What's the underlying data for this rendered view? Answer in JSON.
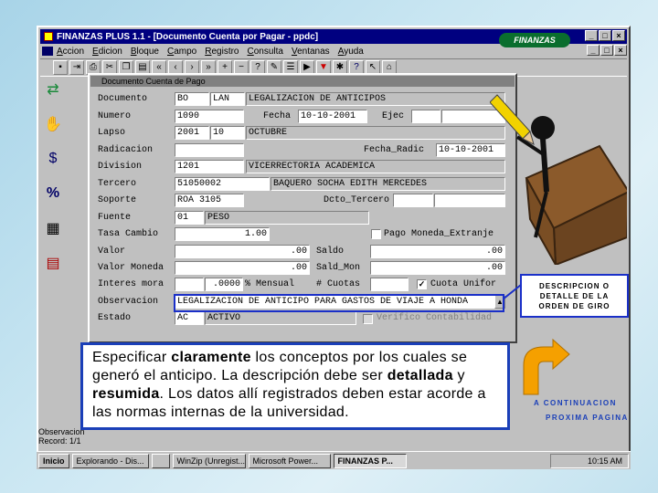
{
  "window": {
    "title": "FINANZAS PLUS 1.1 - [Documento Cuenta por Pagar - ppdc]",
    "menu": [
      "Accion",
      "Edicion",
      "Bloque",
      "Campo",
      "Registro",
      "Consulta",
      "Ventanas",
      "Ayuda"
    ],
    "brand": "FINANZAS"
  },
  "doc": {
    "title": "Documento Cuenta de Pago",
    "labels": {
      "documento": "Documento",
      "numero": "Numero",
      "fecha": "Fecha",
      "ejec": "Ejec",
      "lapso": "Lapso",
      "radicacion": "Radicacion",
      "fecha_radic": "Fecha_Radic",
      "division": "Division",
      "tercero": "Tercero",
      "soporte": "Soporte",
      "dcto_tercero": "Dcto_Tercero",
      "fuente": "Fuente",
      "tasa_cambio": "Tasa Cambio",
      "pago_moneda": "Pago Moneda_Extranje",
      "valor": "Valor",
      "saldo": "Saldo",
      "valor_moneda": "Valor Moneda",
      "saldo_mon": "Sald_Mon",
      "interes_mora": "Interes mora",
      "porc_mensual": "% Mensual",
      "num_cuotas": "# Cuotas",
      "cuota_unifor": "Cuota Unifor",
      "observacion": "Observacion",
      "estado": "Estado",
      "verifico": "Verifico Contabilidad"
    },
    "values": {
      "documento_a": "BO",
      "documento_b": "LAN",
      "documento_desc": "LEGALIZACION DE ANTICIPOS",
      "numero": "1090",
      "fecha": "10-10-2001",
      "ejec": "",
      "ejec2": "",
      "lapso_a": "2001",
      "lapso_b": "10",
      "lapso_desc": "OCTUBRE",
      "radicacion": "",
      "fecha_radic": "10-10-2001",
      "division": "1201",
      "division_desc": "VICERRECTORIA ACADEMICA",
      "tercero": "51050002",
      "tercero_desc": "BAQUERO SOCHA EDITH MERCEDES",
      "soporte": "ROA 3105",
      "dcto_tercero": "",
      "dcto2": "",
      "fuente_a": "01",
      "fuente_desc": "PESO",
      "tasa_cambio": "1.00",
      "valor": ".00",
      "saldo": ".00",
      "valor_moneda": ".00",
      "saldo_mon": ".00",
      "interes_mora": "",
      "porc_mensual": ".0000",
      "num_cuotas": "",
      "observacion": "LEGALIZACION DE ANTICIPO PARA GASTOS DE VIAJE A HONDA",
      "estado_a": "AC",
      "estado_desc": "ACTIVO"
    },
    "checks": {
      "pago_moneda": false,
      "cuota_unifor": true,
      "verifico": false
    }
  },
  "callout": "DESCRIPCION O DETALLE DE LA ORDEN DE GIRO",
  "explanation": {
    "p1": "Especificar ",
    "b1": "claramente",
    "p2": " los conceptos por los cuales se generó el anticipo. La descripción debe ser ",
    "b2": "detallada",
    "p3": " y ",
    "b3": "resumida",
    "p4": ". Los datos allí registrados deben estar acorde a las normas internas de la universidad."
  },
  "nav": {
    "line1": "A CONTINUACION",
    "line2": "PROXIMA PAGINA"
  },
  "status": {
    "line1": "Observacion",
    "line2": "Record: 1/1"
  },
  "taskbar": {
    "start": "Inicio",
    "items": [
      "Explorando - Dis...",
      "",
      "WinZip (Unregist...",
      "Microsoft Power...",
      "FINANZAS P..."
    ],
    "clock": "10:15 AM"
  },
  "colors": {
    "accent": "#1a3fb8",
    "titlebar": "#000080",
    "window": "#c0c0c0"
  }
}
